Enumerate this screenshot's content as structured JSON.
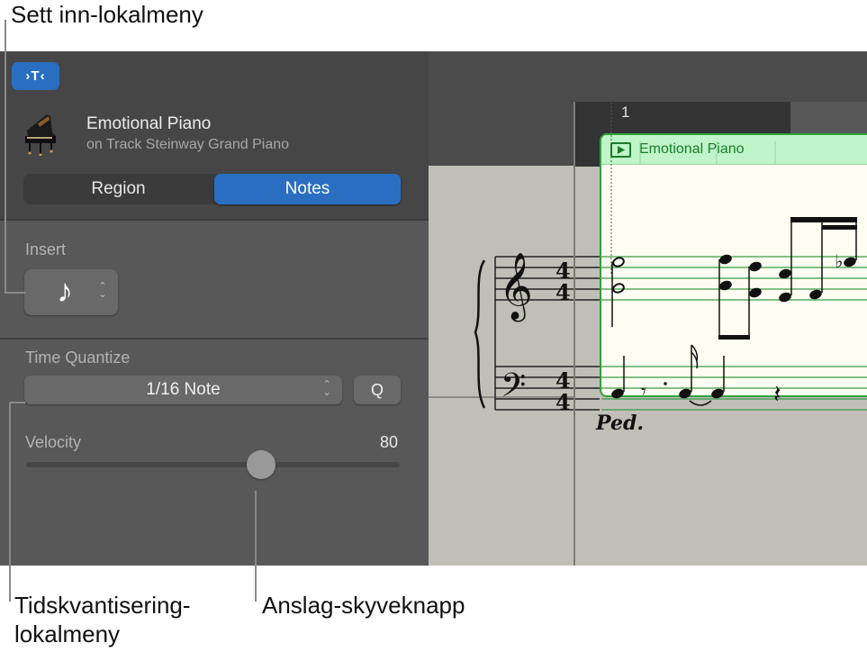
{
  "callouts": {
    "insert": "Sett inn-lokalmeny",
    "quantize_line1": "Tidskvantisering-",
    "quantize_line2": "lokalmeny",
    "velocity": "Anslag-skyveknapp"
  },
  "inspector": {
    "toolbar_button_icon": "inspector-filter-icon",
    "toolbar_button_glyph": "›T‹",
    "region_name": "Emotional Piano",
    "region_track": "on Track Steinway Grand Piano",
    "tabs": [
      {
        "label": "Region",
        "selected": false
      },
      {
        "label": "Notes",
        "selected": true
      }
    ],
    "insert": {
      "label": "Insert",
      "value_glyph": "♪",
      "value_icon": "eighth-note-icon"
    },
    "time_quantize": {
      "label": "Time Quantize",
      "value": "1/16 Note",
      "q_button": "Q"
    },
    "velocity": {
      "label": "Velocity",
      "value": "80",
      "slider_fraction": 0.63
    }
  },
  "score": {
    "bar_number": "1",
    "region_name": "Emotional Piano",
    "time_signature_treble": [
      "4",
      "4"
    ],
    "time_signature_bass": [
      "4",
      "4"
    ],
    "pedal_marking": "Ped.",
    "colors": {
      "region_border": "#2da23a",
      "region_header": "#bff5c8",
      "paper": "#c0bfb7",
      "accent": "#2a6ec2"
    }
  }
}
